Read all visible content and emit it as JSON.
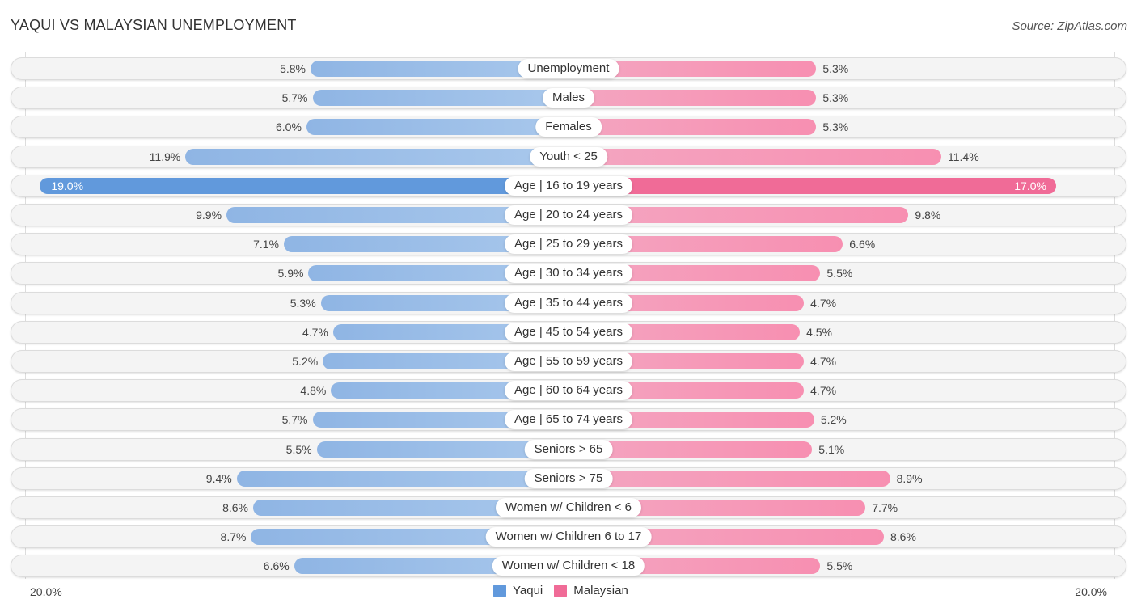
{
  "title": "YAQUI VS MALAYSIAN UNEMPLOYMENT",
  "source": "Source: ZipAtlas.com",
  "colors": {
    "yaqui": "#6199dc",
    "malaysian": "#f06b97"
  },
  "chart_data": {
    "type": "bar",
    "orientation": "horizontal-diverging",
    "title": "YAQUI VS MALAYSIAN UNEMPLOYMENT",
    "categories": [
      "Unemployment",
      "Males",
      "Females",
      "Youth < 25",
      "Age | 16 to 19 years",
      "Age | 20 to 24 years",
      "Age | 25 to 29 years",
      "Age | 30 to 34 years",
      "Age | 35 to 44 years",
      "Age | 45 to 54 years",
      "Age | 55 to 59 years",
      "Age | 60 to 64 years",
      "Age | 65 to 74 years",
      "Seniors > 65",
      "Seniors > 75",
      "Women w/ Children < 6",
      "Women w/ Children 6 to 17",
      "Women w/ Children < 18"
    ],
    "series": [
      {
        "name": "Yaqui",
        "side": "left",
        "values": [
          5.8,
          5.7,
          6.0,
          11.9,
          19.0,
          9.9,
          7.1,
          5.9,
          5.3,
          4.7,
          5.2,
          4.8,
          5.7,
          5.5,
          9.4,
          8.6,
          8.7,
          6.6
        ],
        "labels": [
          "5.8%",
          "5.7%",
          "6.0%",
          "11.9%",
          "19.0%",
          "9.9%",
          "7.1%",
          "5.9%",
          "5.3%",
          "4.7%",
          "5.2%",
          "4.8%",
          "5.7%",
          "5.5%",
          "9.4%",
          "8.6%",
          "8.7%",
          "6.6%"
        ]
      },
      {
        "name": "Malaysian",
        "side": "right",
        "values": [
          5.3,
          5.3,
          5.3,
          11.4,
          17.0,
          9.8,
          6.6,
          5.5,
          4.7,
          4.5,
          4.7,
          4.7,
          5.2,
          5.1,
          8.9,
          7.7,
          8.6,
          5.5
        ],
        "labels": [
          "5.3%",
          "5.3%",
          "5.3%",
          "11.4%",
          "17.0%",
          "9.8%",
          "6.6%",
          "5.5%",
          "4.7%",
          "4.5%",
          "4.7%",
          "4.7%",
          "5.2%",
          "5.1%",
          "8.9%",
          "7.7%",
          "8.6%",
          "5.5%"
        ]
      }
    ],
    "highlight_index": 4,
    "axis_min_label": "20.0%",
    "axis_max_label": "20.0%",
    "xlim": [
      -20,
      20
    ],
    "legend": {
      "position": "bottom-center",
      "entries": [
        "Yaqui",
        "Malaysian"
      ]
    }
  }
}
